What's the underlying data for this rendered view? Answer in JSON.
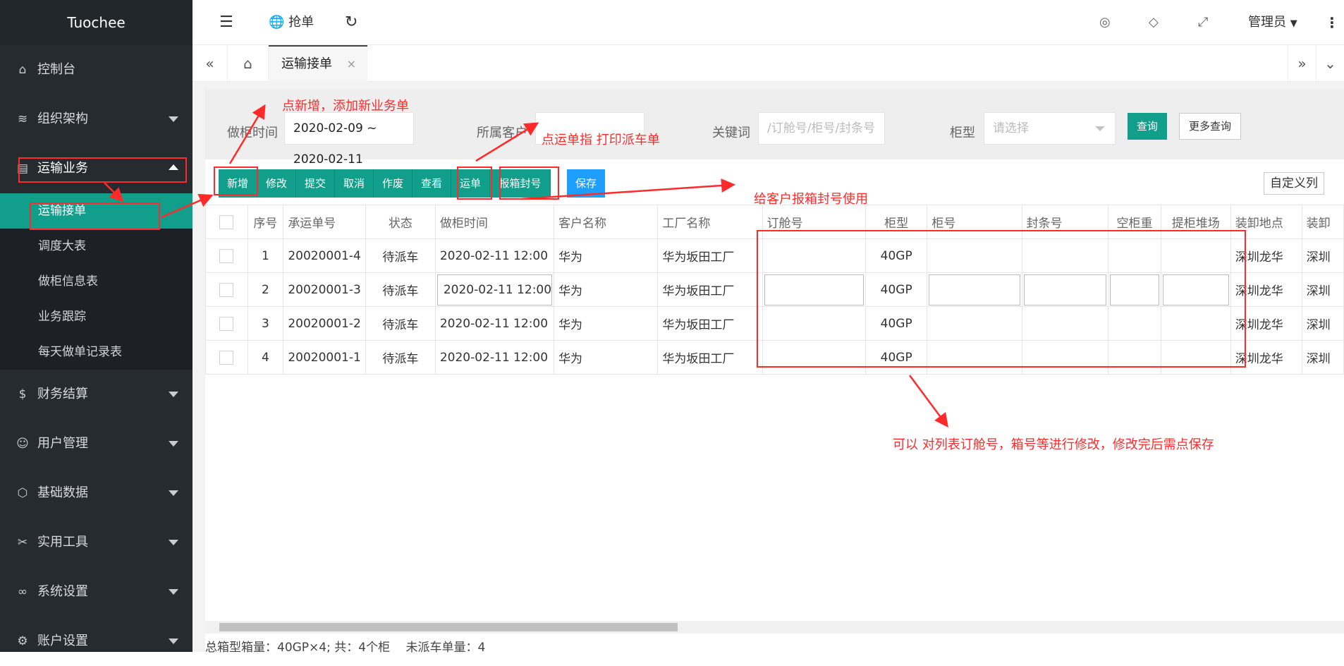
{
  "app": {
    "brand": "Tuochee"
  },
  "sidebar": {
    "items": [
      {
        "label": "控制台",
        "icon": "home-icon"
      },
      {
        "label": "组织架构",
        "icon": "layers-icon"
      },
      {
        "label": "运输业务",
        "icon": "document-icon"
      },
      {
        "label": "财务结算",
        "icon": "dollar-icon"
      },
      {
        "label": "用户管理",
        "icon": "user-icon"
      },
      {
        "label": "基础数据",
        "icon": "cube-icon"
      },
      {
        "label": "实用工具",
        "icon": "tools-icon"
      },
      {
        "label": "系统设置",
        "icon": "infinity-icon"
      },
      {
        "label": "账户设置",
        "icon": "gear-icon"
      }
    ],
    "sub_items": [
      "运输接单",
      "调度大表",
      "做柜信息表",
      "业务跟踪",
      "每天做单记录表"
    ]
  },
  "topbar": {
    "grab_label": "抢单",
    "user_label": "管理员"
  },
  "tabs": {
    "active_label": "运输接单",
    "close": "×"
  },
  "search": {
    "date_label": "做柜时间",
    "date_value": "2020-02-09 ~ 2020-02-11",
    "customer_label": "所属客户",
    "customer_value": "",
    "keyword_label": "关键词",
    "keyword_placeholder": "/订舱号/柜号/封条号",
    "type_label": "柜型",
    "type_placeholder": "请选择",
    "query": "查询",
    "more_query": "更多查询"
  },
  "toolbar": {
    "buttons": [
      "新增",
      "修改",
      "提交",
      "取消",
      "作废",
      "查看",
      "运单",
      "报箱封号"
    ],
    "save": "保存",
    "custom_columns": "自定义列"
  },
  "table": {
    "headers": [
      "序号",
      "承运单号",
      "状态",
      "做柜时间",
      "客户名称",
      "工厂名称",
      "订舱号",
      "柜型",
      "柜号",
      "封条号",
      "空柜重",
      "提柜堆场",
      "装卸地点",
      "装卸"
    ],
    "rows": [
      [
        "1",
        "20020001-4",
        "待派车",
        "2020-02-11 12:00",
        "华为",
        "华为坂田工厂",
        "",
        "40GP",
        "",
        "",
        "",
        "",
        "深圳龙华",
        "深圳"
      ],
      [
        "2",
        "20020001-3",
        "待派车",
        "2020-02-11 12:00",
        "华为",
        "华为坂田工厂",
        "",
        "40GP",
        "",
        "",
        "",
        "",
        "深圳龙华",
        "深圳"
      ],
      [
        "3",
        "20020001-2",
        "待派车",
        "2020-02-11 12:00",
        "华为",
        "华为坂田工厂",
        "",
        "40GP",
        "",
        "",
        "",
        "",
        "深圳龙华",
        "深圳"
      ],
      [
        "4",
        "20020001-1",
        "待派车",
        "2020-02-11 12:00",
        "华为",
        "华为坂田工厂",
        "",
        "40GP",
        "",
        "",
        "",
        "",
        "深圳龙华",
        "深圳"
      ]
    ]
  },
  "footer": {
    "summary": "总箱型箱量：40GP×4; 共：4个柜　 未派车单量：4"
  },
  "annotations": {
    "add": "点新增，添加新业务单",
    "waybill": "点运单指 打印派车单",
    "seal": "给客户报箱封号使用",
    "edit": "可以 对列表订舱号，箱号等进行修改，修改完后需点保存"
  },
  "colors": {
    "sidebar": "#262b30",
    "accent": "#119e8a",
    "save": "#1e9fff",
    "annotation": "#ff2a2a"
  }
}
